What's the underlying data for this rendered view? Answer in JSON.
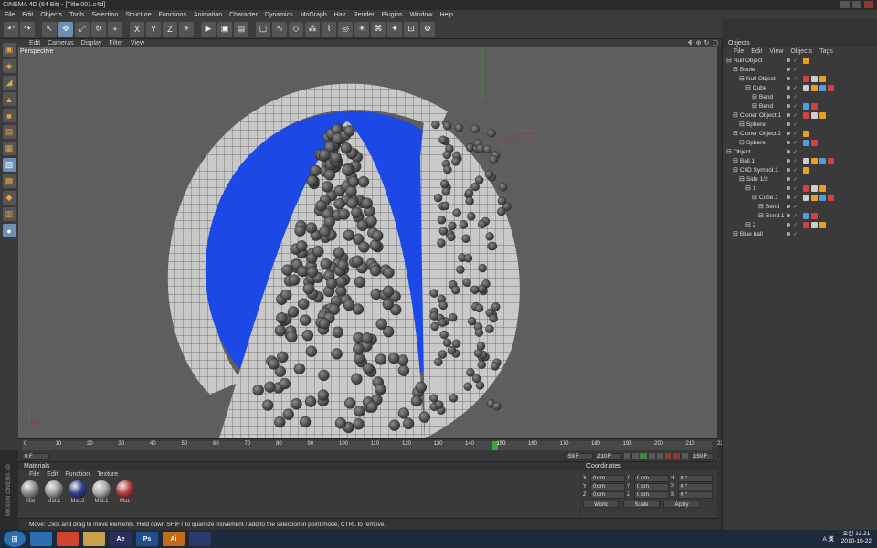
{
  "window": {
    "title": "CINEMA 4D (64 Bit) - [Title 001.c4d]"
  },
  "menu": [
    "File",
    "Edit",
    "Objects",
    "Tools",
    "Selection",
    "Structure",
    "Functions",
    "Animation",
    "Character",
    "Dynamics",
    "MoGraph",
    "Hair",
    "Render",
    "Plugins",
    "Window",
    "Help"
  ],
  "toolbar": {
    "icons": [
      "undo-icon",
      "redo-icon",
      "select-icon",
      "move-icon",
      "scale-icon",
      "rotate-icon",
      "add-icon",
      "x-axis-icon",
      "y-axis-icon",
      "z-axis-icon",
      "coord-icon",
      "render-view-icon",
      "render-icon",
      "render-settings-icon",
      "cube-icon",
      "spline-icon",
      "nurbs-icon",
      "array-icon",
      "deformer-icon",
      "scene-icon",
      "light-icon",
      "camera-icon",
      "effector-icon",
      "render-region-icon",
      "settings-icon"
    ]
  },
  "viewport": {
    "menu": [
      "Edit",
      "Cameras",
      "Display",
      "Filter",
      "View"
    ],
    "label": "Perspective",
    "colors": {
      "sphere": "#1c49e6",
      "background": "#5e5e5e"
    }
  },
  "timeline": {
    "ticks": [
      "0",
      "10",
      "20",
      "30",
      "40",
      "50",
      "60",
      "70",
      "80",
      "90",
      "100",
      "110",
      "120",
      "130",
      "140",
      "150",
      "160",
      "170",
      "180",
      "190",
      "200",
      "210",
      "220"
    ],
    "current": "150",
    "end_field": "150 F"
  },
  "playback": {
    "start_field": "0 F",
    "field2": "59 F",
    "field3": "210 F"
  },
  "materials": {
    "title": "Materials",
    "menu": [
      "File",
      "Edit",
      "Function",
      "Texture"
    ],
    "items": [
      {
        "label": "Mat",
        "color": "#8a8a8a"
      },
      {
        "label": "Mat.1",
        "color": "#9a9a9a"
      },
      {
        "label": "Mat.2",
        "color": "#2d3f8a"
      },
      {
        "label": "Mat.1",
        "color": "#aaaaaa"
      },
      {
        "label": "Mat.",
        "color": "#b53a3a"
      }
    ]
  },
  "coordinates": {
    "title": "Coordinates",
    "rows": [
      {
        "a": "X",
        "av": "0 cm",
        "b": "X",
        "bv": "0 cm",
        "c": "H",
        "cv": "0 °"
      },
      {
        "a": "Y",
        "av": "0 cm",
        "b": "Y",
        "bv": "0 cm",
        "c": "P",
        "cv": "0 °"
      },
      {
        "a": "Z",
        "av": "0 cm",
        "b": "Z",
        "bv": "0 cm",
        "c": "B",
        "cv": "0 °"
      }
    ],
    "mode1": "World",
    "mode2": "Scale",
    "apply": "Apply"
  },
  "status": "Move: Click and drag to move elements. Hold down SHIFT to quantize movement / add to the selection in point mode, CTRL to remove.",
  "objects": {
    "title": "Objects",
    "menu": [
      "File",
      "Edit",
      "View",
      "Objects",
      "Tags"
    ],
    "rows": [
      {
        "name": "Null Object",
        "indent": 0
      },
      {
        "name": "Boole",
        "indent": 1
      },
      {
        "name": "Null Object",
        "indent": 2
      },
      {
        "name": "Cube",
        "indent": 3
      },
      {
        "name": "Bend",
        "indent": 4
      },
      {
        "name": "Bend",
        "indent": 4
      },
      {
        "name": "Cloner Object 1",
        "indent": 1
      },
      {
        "name": "Sphere",
        "indent": 2
      },
      {
        "name": "Cloner Object 2",
        "indent": 1
      },
      {
        "name": "Sphere",
        "indent": 2
      },
      {
        "name": "Object",
        "indent": 0
      },
      {
        "name": "Ball.1",
        "indent": 1
      },
      {
        "name": "C4D Symbol.1",
        "indent": 1
      },
      {
        "name": "Side 1/2",
        "indent": 2
      },
      {
        "name": "1",
        "indent": 3
      },
      {
        "name": "Cube.1",
        "indent": 4
      },
      {
        "name": "Bend",
        "indent": 5
      },
      {
        "name": "Bend.1",
        "indent": 5
      },
      {
        "name": "2",
        "indent": 3
      },
      {
        "name": "Blue ball",
        "indent": 1
      }
    ]
  },
  "taskbar": {
    "apps": [
      {
        "label": "",
        "color": "#2a6fb0"
      },
      {
        "label": "",
        "color": "#d0442c"
      },
      {
        "label": "",
        "color": "#c7a24a"
      },
      {
        "label": "Ae",
        "color": "#2b2f5a"
      },
      {
        "label": "Ps",
        "color": "#1e4f8a"
      },
      {
        "label": "Ai",
        "color": "#c76b12"
      },
      {
        "label": "",
        "color": "#2b3a6a"
      }
    ],
    "tray_lang": "A 漢",
    "time": "오전 12:21",
    "date": "2010-10-22"
  }
}
